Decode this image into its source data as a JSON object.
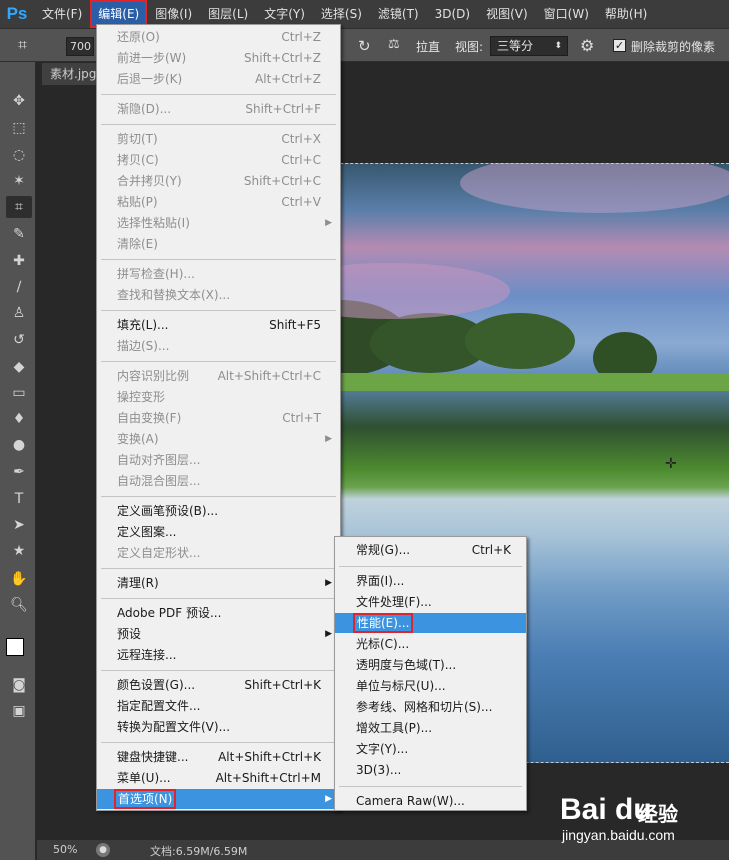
{
  "app": {
    "logo": "Ps"
  },
  "menubar": [
    {
      "label": "文件(F)",
      "name": "menu-file"
    },
    {
      "label": "编辑(E)",
      "name": "menu-edit",
      "active": true
    },
    {
      "label": "图像(I)",
      "name": "menu-image"
    },
    {
      "label": "图层(L)",
      "name": "menu-layer"
    },
    {
      "label": "文字(Y)",
      "name": "menu-type"
    },
    {
      "label": "选择(S)",
      "name": "menu-select"
    },
    {
      "label": "滤镜(T)",
      "name": "menu-filter"
    },
    {
      "label": "3D(D)",
      "name": "menu-3d"
    },
    {
      "label": "视图(V)",
      "name": "menu-view"
    },
    {
      "label": "窗口(W)",
      "name": "menu-window"
    },
    {
      "label": "帮助(H)",
      "name": "menu-help"
    }
  ],
  "options": {
    "ratio_value": "700",
    "straighten": "拉直",
    "view_label": "视图:",
    "view_value": "三等分",
    "delete_cropped": "删除裁剪的像素",
    "delete_checked": true
  },
  "document": {
    "tab": "素材.jpg",
    "zoom": "50%",
    "doc_size": "文档:6.59M/6.59M"
  },
  "edit_menu": [
    {
      "label": "还原(O)",
      "shortcut": "Ctrl+Z",
      "disabled": true
    },
    {
      "label": "前进一步(W)",
      "shortcut": "Shift+Ctrl+Z",
      "disabled": true
    },
    {
      "label": "后退一步(K)",
      "shortcut": "Alt+Ctrl+Z",
      "disabled": true
    },
    {
      "sep": true
    },
    {
      "label": "渐隐(D)...",
      "shortcut": "Shift+Ctrl+F",
      "disabled": true
    },
    {
      "sep": true
    },
    {
      "label": "剪切(T)",
      "shortcut": "Ctrl+X",
      "disabled": true
    },
    {
      "label": "拷贝(C)",
      "shortcut": "Ctrl+C",
      "disabled": true
    },
    {
      "label": "合并拷贝(Y)",
      "shortcut": "Shift+Ctrl+C",
      "disabled": true
    },
    {
      "label": "粘贴(P)",
      "shortcut": "Ctrl+V",
      "disabled": true
    },
    {
      "label": "选择性粘贴(I)",
      "submenu": true,
      "disabled": true
    },
    {
      "label": "清除(E)",
      "disabled": true
    },
    {
      "sep": true
    },
    {
      "label": "拼写检查(H)...",
      "disabled": true
    },
    {
      "label": "查找和替换文本(X)...",
      "disabled": true
    },
    {
      "sep": true
    },
    {
      "label": "填充(L)...",
      "shortcut": "Shift+F5"
    },
    {
      "label": "描边(S)...",
      "disabled": true
    },
    {
      "sep": true
    },
    {
      "label": "内容识别比例",
      "shortcut": "Alt+Shift+Ctrl+C",
      "disabled": true
    },
    {
      "label": "操控变形",
      "disabled": true
    },
    {
      "label": "自由变换(F)",
      "shortcut": "Ctrl+T",
      "disabled": true
    },
    {
      "label": "变换(A)",
      "submenu": true,
      "disabled": true
    },
    {
      "label": "自动对齐图层...",
      "disabled": true
    },
    {
      "label": "自动混合图层...",
      "disabled": true
    },
    {
      "sep": true
    },
    {
      "label": "定义画笔预设(B)..."
    },
    {
      "label": "定义图案..."
    },
    {
      "label": "定义自定形状...",
      "disabled": true
    },
    {
      "sep": true
    },
    {
      "label": "清理(R)",
      "submenu": true
    },
    {
      "sep": true
    },
    {
      "label": "Adobe PDF 预设..."
    },
    {
      "label": "预设",
      "submenu": true
    },
    {
      "label": "远程连接..."
    },
    {
      "sep": true
    },
    {
      "label": "颜色设置(G)...",
      "shortcut": "Shift+Ctrl+K"
    },
    {
      "label": "指定配置文件..."
    },
    {
      "label": "转换为配置文件(V)..."
    },
    {
      "sep": true
    },
    {
      "label": "键盘快捷键...",
      "shortcut": "Alt+Shift+Ctrl+K"
    },
    {
      "label": "菜单(U)...",
      "shortcut": "Alt+Shift+Ctrl+M"
    },
    {
      "label": "首选项(N)",
      "submenu": true,
      "highlight": true,
      "boxed": true
    }
  ],
  "prefs_menu": [
    {
      "label": "常规(G)...",
      "shortcut": "Ctrl+K"
    },
    {
      "sep": true
    },
    {
      "label": "界面(I)..."
    },
    {
      "label": "文件处理(F)..."
    },
    {
      "label": "性能(E)...",
      "highlight": true,
      "boxed": true
    },
    {
      "label": "光标(C)..."
    },
    {
      "label": "透明度与色域(T)..."
    },
    {
      "label": "单位与标尺(U)..."
    },
    {
      "label": "参考线、网格和切片(S)..."
    },
    {
      "label": "增效工具(P)..."
    },
    {
      "label": "文字(Y)..."
    },
    {
      "label": "3D(3)..."
    },
    {
      "sep": true
    },
    {
      "label": "Camera Raw(W)..."
    }
  ],
  "watermark": {
    "brand": "Bai du",
    "subbrand": "经验",
    "url": "jingyan.baidu.com"
  },
  "colors": {
    "highlight": "#3c94e0",
    "red_box": "#e0242b",
    "menu_bg": "#f0f0f0"
  }
}
